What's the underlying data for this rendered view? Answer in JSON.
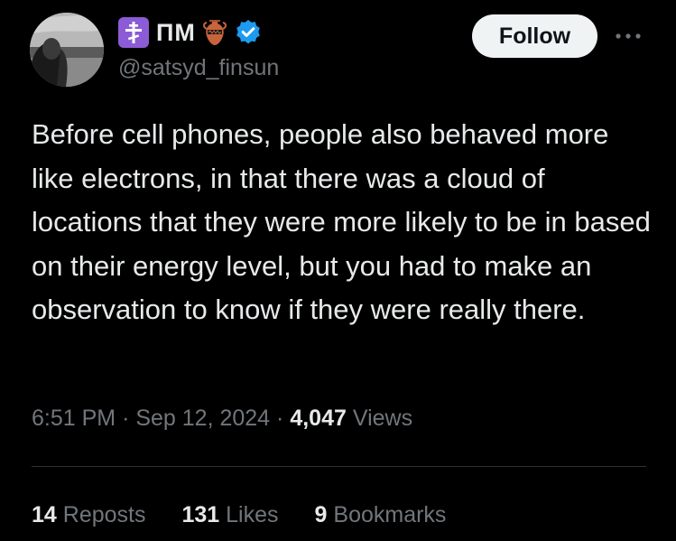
{
  "author": {
    "display_name": "ПМ",
    "handle": "@satsyd_finsun",
    "badges": [
      "orthodox-cross-icon",
      "amphora-icon",
      "verified-icon"
    ]
  },
  "actions": {
    "follow_label": "Follow",
    "more_icon": "more-icon"
  },
  "tweet": {
    "text": "Before cell phones, people also behaved more like electrons, in that there was a cloud of locations that they were more likely to be in based on their energy level, but you had to make an observation to know if they were really there.",
    "time": "6:51 PM",
    "date": "Sep 12, 2024",
    "views_count": "4,047",
    "views_label": "Views"
  },
  "stats": {
    "reposts_count": "14",
    "reposts_label": "Reposts",
    "likes_count": "131",
    "likes_label": "Likes",
    "bookmarks_count": "9",
    "bookmarks_label": "Bookmarks"
  },
  "colors": {
    "background": "#000000",
    "primary_text": "#e7e9ea",
    "secondary_text": "#71767b",
    "verified_blue": "#1d9bf0",
    "badge_purple": "#8c5bd6",
    "button_bg": "#eff3f4"
  }
}
